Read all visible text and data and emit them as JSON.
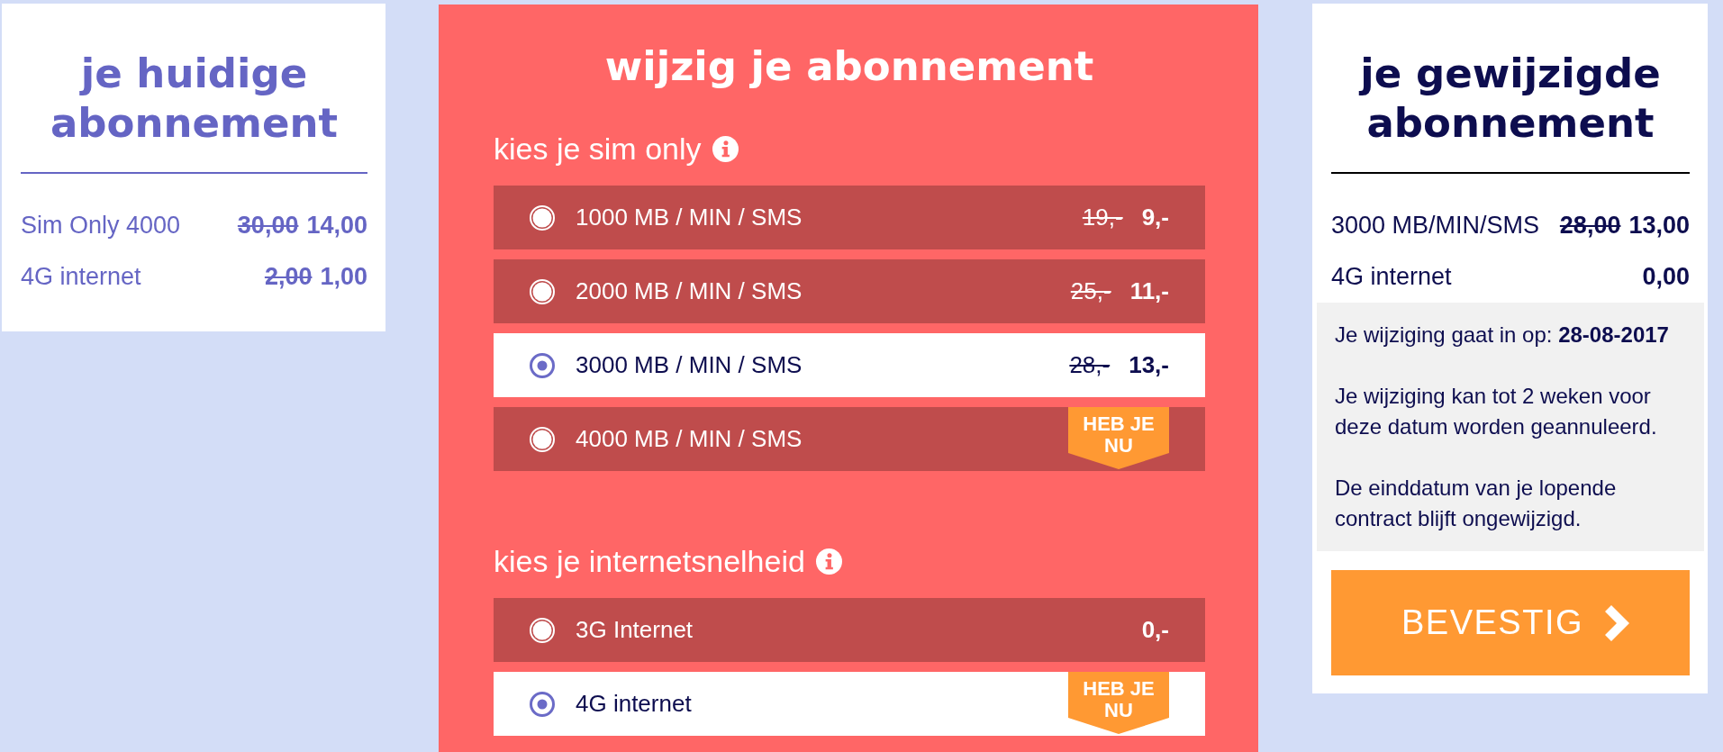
{
  "current_plan": {
    "title": "je huidige abonnement",
    "lines": [
      {
        "label": "Sim Only 4000",
        "old_price": "30,00",
        "price": "14,00"
      },
      {
        "label": "4G internet",
        "old_price": "2,00",
        "price": "1,00"
      }
    ]
  },
  "change_plan": {
    "title": "wijzig je abonnement",
    "sections": [
      {
        "heading": "kies je sim only",
        "options": [
          {
            "label": "1000 MB / MIN / SMS",
            "old_price": "19,-",
            "price": "9,-",
            "selected": false
          },
          {
            "label": "2000 MB / MIN / SMS",
            "old_price": "25,-",
            "price": "11,-",
            "selected": false
          },
          {
            "label": "3000 MB / MIN / SMS",
            "old_price": "28,-",
            "price": "13,-",
            "selected": true
          },
          {
            "label": "4000 MB / MIN / SMS",
            "badge": "HEB JE NU",
            "selected": false
          }
        ]
      },
      {
        "heading": "kies je internetsnelheid",
        "options": [
          {
            "label": "3G Internet",
            "price": "0,-",
            "selected": false
          },
          {
            "label": "4G internet",
            "badge": "HEB JE NU",
            "selected": true
          }
        ]
      }
    ]
  },
  "new_plan": {
    "title": "je gewijzigde abonnement",
    "lines": [
      {
        "label": "3000 MB/MIN/SMS",
        "old_price": "28,00",
        "price": "13,00"
      },
      {
        "label": "4G internet",
        "price": "0,00"
      }
    ],
    "notice": [
      "Je wijziging gaat in op: **28-08-2017**",
      "Je wijziging kan tot 2 weken voor deze datum worden geannuleerd.",
      "De einddatum van je lopende contract blijft ongewijzigd."
    ],
    "button": "BEVESTIG"
  }
}
